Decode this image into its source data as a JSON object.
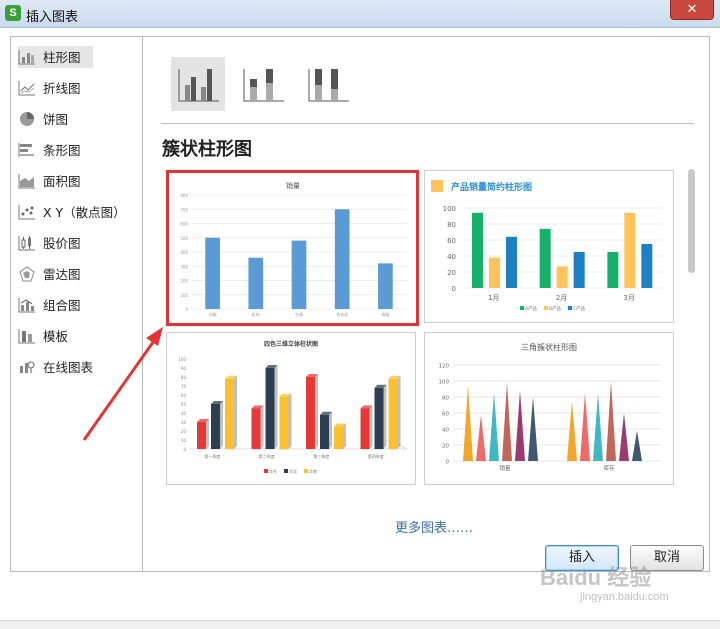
{
  "window": {
    "title": "插入图表",
    "app_icon": "S",
    "close_glyph": "✕"
  },
  "sidebar": {
    "items": [
      {
        "label": "柱形图",
        "icon": "column-chart-icon",
        "active": true
      },
      {
        "label": "折线图",
        "icon": "line-chart-icon"
      },
      {
        "label": "饼图",
        "icon": "pie-chart-icon"
      },
      {
        "label": "条形图",
        "icon": "bar-chart-icon"
      },
      {
        "label": "面积图",
        "icon": "area-chart-icon"
      },
      {
        "label": "X Y（散点图）",
        "icon": "scatter-chart-icon"
      },
      {
        "label": "股价图",
        "icon": "stock-chart-icon"
      },
      {
        "label": "雷达图",
        "icon": "radar-chart-icon"
      },
      {
        "label": "组合图",
        "icon": "combo-chart-icon"
      },
      {
        "label": "模板",
        "icon": "template-icon"
      },
      {
        "label": "在线图表",
        "icon": "online-chart-icon"
      }
    ]
  },
  "main": {
    "section_title": "簇状柱形图",
    "more_link": "更多图表……",
    "thumbs": [
      {
        "title": "销量",
        "selected": true,
        "y_ticks": [
          "800",
          "700",
          "600",
          "500",
          "400",
          "300",
          "200",
          "100",
          "0"
        ],
        "categories": [
          "冰箱",
          "彩电",
          "空调",
          "洗衣机",
          "电脑"
        ],
        "values": [
          500,
          360,
          480,
          700,
          320
        ],
        "color": "#5b9bd5"
      },
      {
        "title": "产品销量简约柱形图",
        "y_ticks": [
          "100",
          "80",
          "60",
          "40",
          "20",
          "0"
        ],
        "categories": [
          "1月",
          "2月",
          "3月"
        ],
        "series": [
          {
            "name": "A产品",
            "color": "#17b26a",
            "values": [
              94,
              74,
              45
            ]
          },
          {
            "name": "B产品",
            "color": "#ffc35a",
            "values": [
              38,
              27,
              94
            ]
          },
          {
            "name": "C产品",
            "color": "#1d7fc4",
            "values": [
              64,
              45,
              55
            ]
          }
        ],
        "accent": "#ffc35a",
        "title_color": "#2d8fd6"
      },
      {
        "title": "四色三维立体柱状图",
        "y_ticks": [
          "100",
          "90",
          "80",
          "70",
          "60",
          "50",
          "40",
          "30",
          "20",
          "10",
          "0"
        ],
        "categories": [
          "第一季度",
          "第二季度",
          "第三季度",
          "第四季度"
        ],
        "series": [
          {
            "name": "华东",
            "color": "#e53935",
            "values": [
              30,
              45,
              80,
              45
            ]
          },
          {
            "name": "华北",
            "color": "#2c3e50",
            "values": [
              50,
              90,
              38,
              68
            ]
          },
          {
            "name": "华南",
            "color": "#fbc02d",
            "values": [
              78,
              58,
              25,
              78
            ]
          }
        ]
      },
      {
        "title": "三角簇状柱形图",
        "y_ticks": [
          "120",
          "100",
          "80",
          "60",
          "40",
          "20",
          "0"
        ],
        "categories": [
          "销量",
          "库存"
        ],
        "values": [
          [
            95,
            58,
            85,
            98,
            88,
            80
          ],
          [
            75,
            85,
            84,
            99,
            60,
            38
          ]
        ],
        "colors": [
          "#f4a62a",
          "#ef6b6b",
          "#3fb7c4",
          "#c0665b",
          "#9b3b6e",
          "#3f5a70"
        ]
      }
    ]
  },
  "footer": {
    "insert_label": "插入",
    "cancel_label": "取消"
  },
  "watermark": {
    "text": "Baidu 经验",
    "sub": "jingyan.baidu.com"
  }
}
